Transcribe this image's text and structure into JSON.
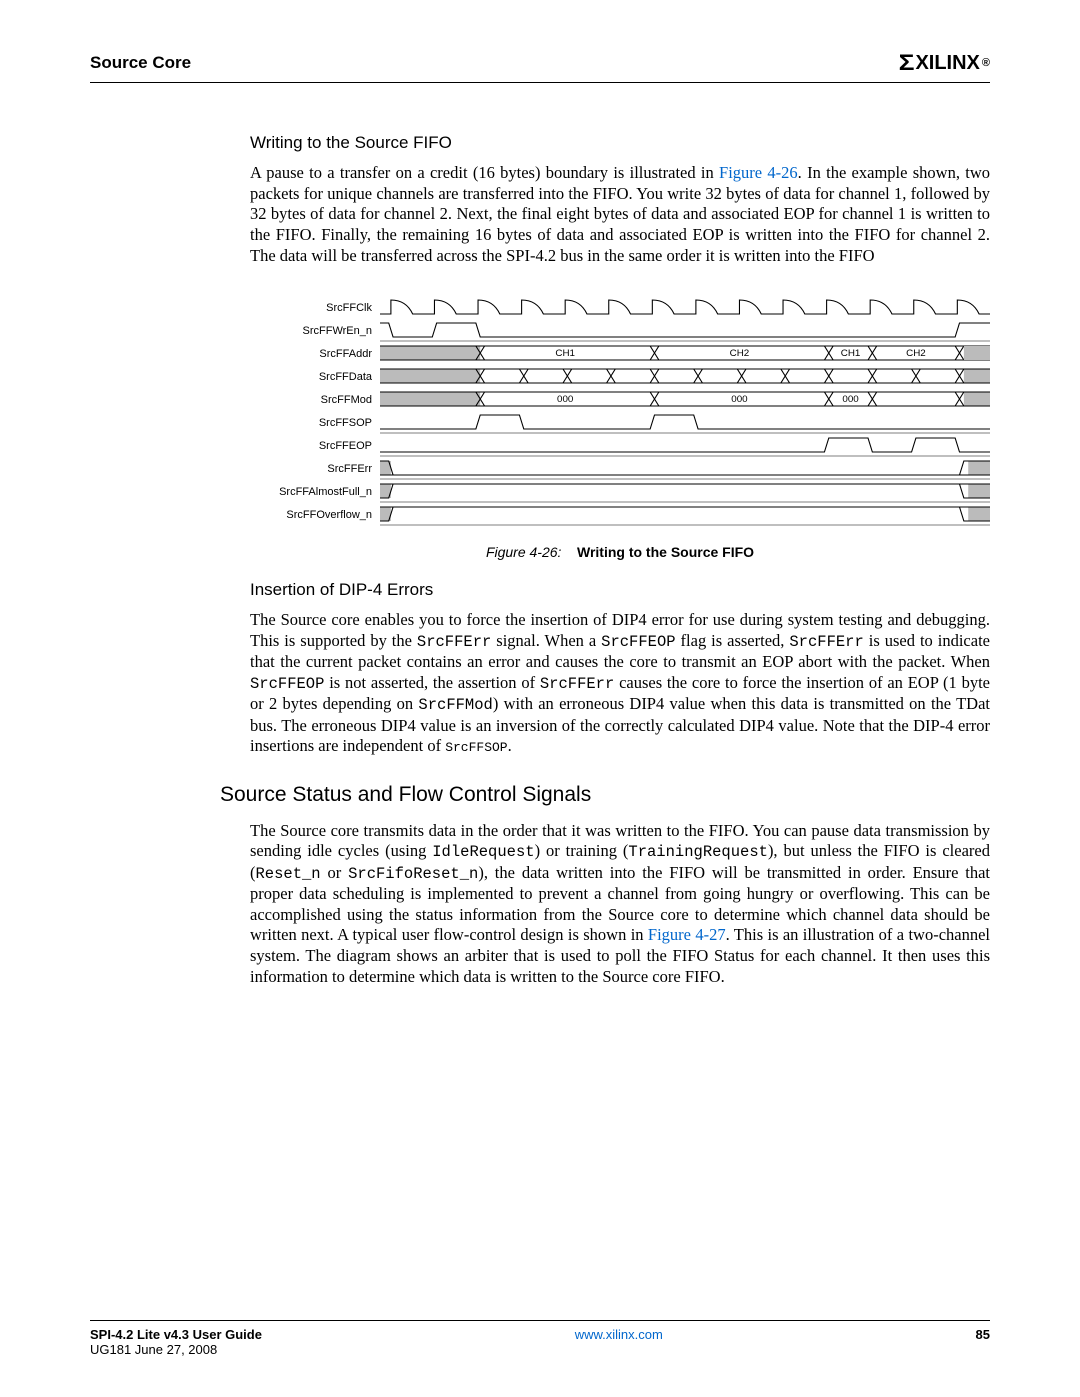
{
  "header": {
    "section": "Source Core",
    "logo_text": "XILINX",
    "logo_reg": "®"
  },
  "sections": {
    "s1_title": "Writing to the Source FIFO",
    "s1_para_pre": "A pause to a transfer on a credit (16 bytes) boundary is illustrated in ",
    "s1_para_link": "Figure 4-26",
    "s1_para_post": ". In the example shown, two packets for unique channels are transferred into the FIFO. You write 32 bytes of data for channel 1, followed by 32 bytes of data for channel 2. Next, the final eight bytes of data and associated EOP for channel 1 is written to the FIFO. Finally, the remaining 16 bytes of data and associated EOP is written into the FIFO for channel 2. The data will be transferred across the SPI-4.2 bus in the same order it is written into the FIFO",
    "s2_title": "Insertion of DIP-4 Errors",
    "s2_p1": "The Source core enables you to force the insertion of DIP4 error for use during system testing and debugging. This is supported by the ",
    "s2_m1": "SrcFFErr",
    "s2_p2": " signal. When a ",
    "s2_m2": "SrcFFEOP",
    "s2_p3": " flag is asserted, ",
    "s2_m3": "SrcFFErr",
    "s2_p4": " is used to indicate that the current packet contains an error and causes the core to transmit an EOP abort with the packet. When ",
    "s2_m4": "SrcFFEOP",
    "s2_p5": " is not asserted, the assertion of ",
    "s2_m5": "SrcFFErr",
    "s2_p6": " causes the core to force the insertion of an EOP (1 byte or 2 bytes depending on ",
    "s2_m6": "SrcFFMod",
    "s2_p7": ") with an erroneous DIP4 value when this data is transmitted on the TDat bus. The erroneous DIP4 value is an inversion of the correctly calculated DIP4 value. Note that the DIP-4 error insertions are independent of ",
    "s2_m7": "SrcFFSOP",
    "s2_p8": ".",
    "s3_title": "Source Status and Flow Control Signals",
    "s3_p1": "The Source core transmits data in the order that it was written to the FIFO. You can pause data transmission by sending idle cycles (using ",
    "s3_m1": "IdleRequest",
    "s3_p2": ") or training (",
    "s3_m2": "TrainingRequest",
    "s3_p3": "), but unless the FIFO is cleared (",
    "s3_m3": "Reset_n",
    "s3_p4": " or ",
    "s3_m4": "SrcFifoReset_n",
    "s3_p5": "), the data written into the FIFO will be transmitted in order. Ensure that proper data scheduling is implemented to prevent a channel from going hungry or overflowing. This can be accomplished using the status information from the Source core to determine which channel data should be written next. A typical user flow-control design is shown in ",
    "s3_link": "Figure 4-27",
    "s3_p6": ". This is an illustration of a two-channel system. The diagram shows an arbiter that is used to poll the FIFO Status for each channel. It then uses this information to determine which data is written to the Source core FIFO."
  },
  "figure": {
    "caption_num": "Figure 4-26:",
    "caption_text": "Writing to the Source FIFO",
    "signals": [
      "SrcFFClk",
      "SrcFFWrEn_n",
      "SrcFFAddr",
      "SrcFFData",
      "SrcFFMod",
      "SrcFFSOP",
      "SrcFFEOP",
      "SrcFFErr",
      "SrcFFAlmostFull_n",
      "SrcFFOverflow_n"
    ],
    "addr_labels": [
      "CH1",
      "CH2",
      "CH1",
      "CH2"
    ],
    "mod_labels": [
      "000",
      "000",
      "000"
    ]
  },
  "footer": {
    "guide": "SPI-4.2 Lite v4.3 User Guide",
    "date": "UG181 June 27, 2008",
    "url": "www.xilinx.com",
    "page": "85"
  }
}
